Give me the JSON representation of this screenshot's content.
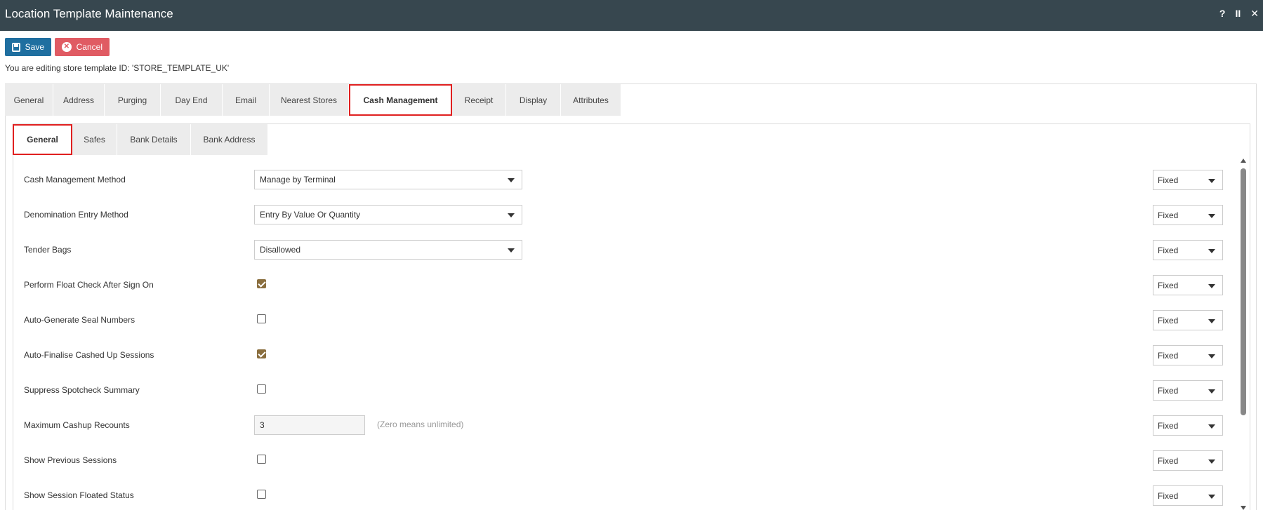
{
  "window": {
    "title": "Location Template Maintenance",
    "icons": [
      "?",
      "II",
      "✕"
    ]
  },
  "toolbar": {
    "save_label": "Save",
    "cancel_label": "Cancel"
  },
  "editing_text": "You are editing store template ID: 'STORE_TEMPLATE_UK'",
  "outer_tabs": [
    {
      "label": "General"
    },
    {
      "label": "Address"
    },
    {
      "label": "Purging"
    },
    {
      "label": "Day End"
    },
    {
      "label": "Email"
    },
    {
      "label": "Nearest Stores"
    },
    {
      "label": "Cash Management",
      "active": true
    },
    {
      "label": "Receipt"
    },
    {
      "label": "Display"
    },
    {
      "label": "Attributes"
    }
  ],
  "inner_tabs": [
    {
      "label": "General",
      "active": true
    },
    {
      "label": "Safes"
    },
    {
      "label": "Bank Details"
    },
    {
      "label": "Bank Address"
    }
  ],
  "fields": [
    {
      "label": "Cash Management Method",
      "type": "select",
      "value": "Manage by Terminal",
      "scope": "Fixed"
    },
    {
      "label": "Denomination Entry Method",
      "type": "select",
      "value": "Entry By Value Or Quantity",
      "scope": "Fixed"
    },
    {
      "label": "Tender Bags",
      "type": "select",
      "value": "Disallowed",
      "scope": "Fixed"
    },
    {
      "label": "Perform Float Check After Sign On",
      "type": "checkbox",
      "checked": true,
      "scope": "Fixed"
    },
    {
      "label": "Auto-Generate Seal Numbers",
      "type": "checkbox",
      "checked": false,
      "scope": "Fixed"
    },
    {
      "label": "Auto-Finalise Cashed Up Sessions",
      "type": "checkbox",
      "checked": true,
      "scope": "Fixed"
    },
    {
      "label": "Suppress Spotcheck Summary",
      "type": "checkbox",
      "checked": false,
      "scope": "Fixed"
    },
    {
      "label": "Maximum Cashup Recounts",
      "type": "number",
      "value": "3",
      "hint": "(Zero means unlimited)",
      "scope": "Fixed"
    },
    {
      "label": "Show Previous Sessions",
      "type": "checkbox",
      "checked": false,
      "scope": "Fixed"
    },
    {
      "label": "Show Session Floated Status",
      "type": "checkbox",
      "checked": false,
      "scope": "Fixed"
    }
  ],
  "colors": {
    "titlebar": "#37474f",
    "save": "#1f6fa0",
    "cancel": "#e05b63",
    "active_tab_outline": "#e02020",
    "checkbox_checked": "#8a6e3e"
  }
}
